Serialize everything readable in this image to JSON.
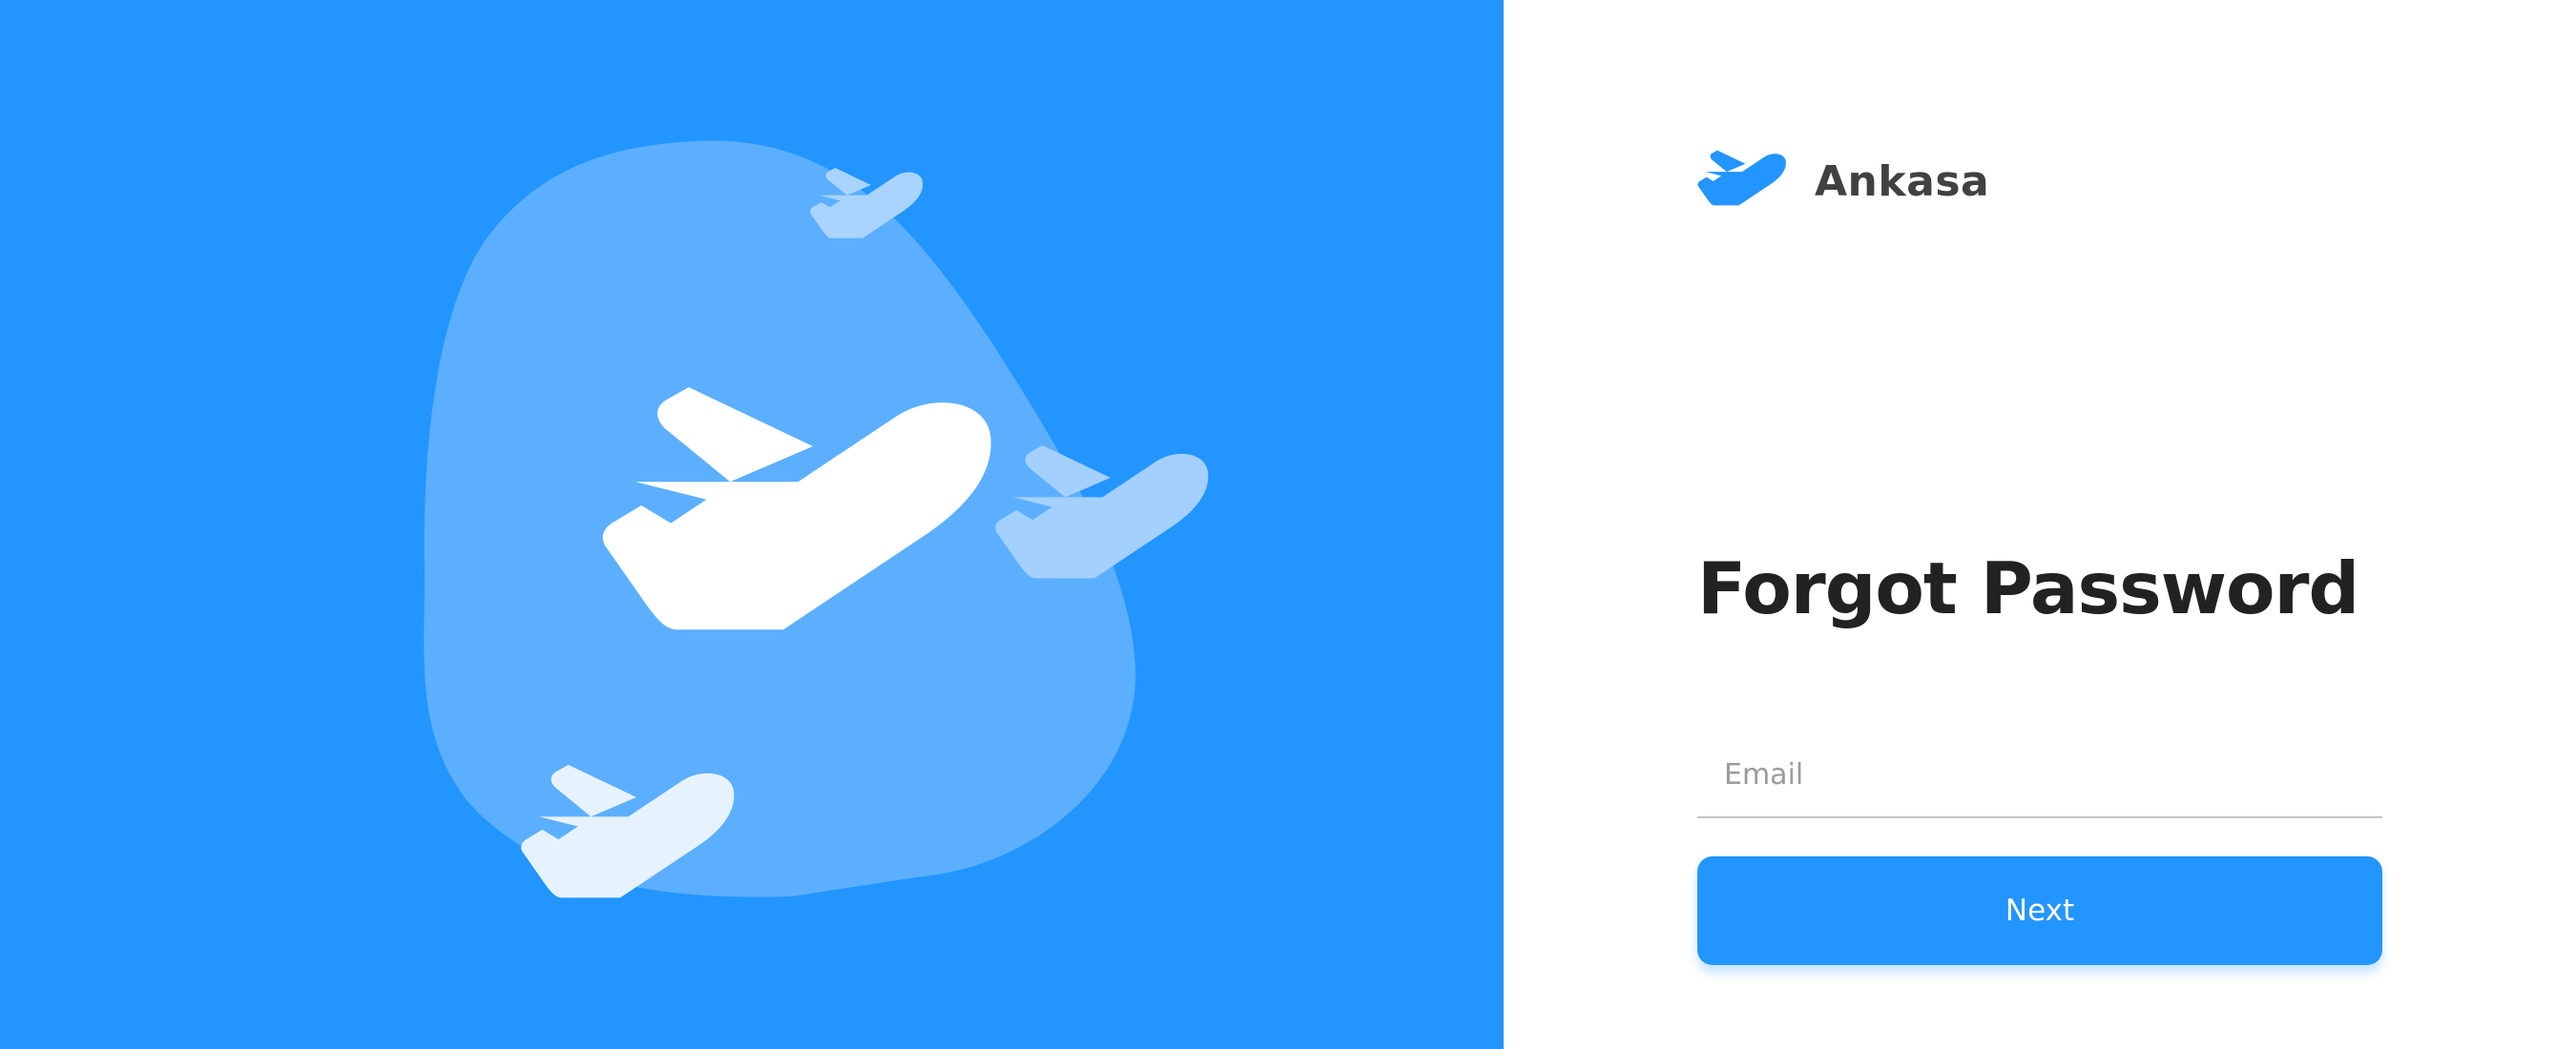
{
  "brand": {
    "name": "Ankasa",
    "logo_icon": "plane-icon"
  },
  "hero": {
    "background_color": "#2395ff",
    "blob_color": "#5cafff",
    "illustration_icons": [
      "plane-icon",
      "plane-icon",
      "plane-icon",
      "plane-icon"
    ]
  },
  "form": {
    "title": "Forgot Password",
    "email_placeholder": "Email",
    "email_value": "",
    "next_label": "Next"
  },
  "colors": {
    "accent": "#2395ff",
    "title": "#222222",
    "brand_text": "#414141"
  }
}
